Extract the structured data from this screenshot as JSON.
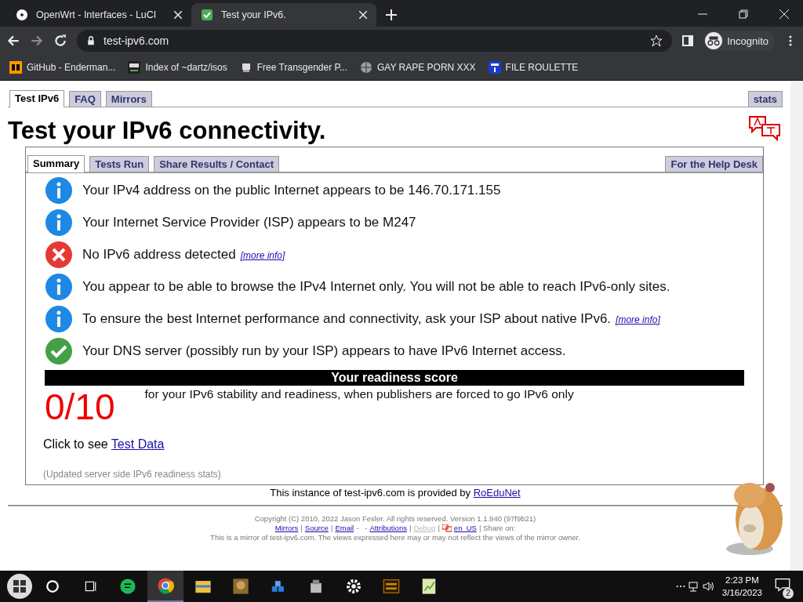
{
  "browser": {
    "tabs": [
      {
        "title": "OpenWrt - Interfaces - LuCI",
        "selected": false
      },
      {
        "title": "Test your IPv6.",
        "selected": true
      }
    ],
    "url": "test-ipv6.com",
    "profile": "Incognito",
    "bookmarks": [
      {
        "label": "GitHub - Enderman..."
      },
      {
        "label": "Index of ~dartz/isos"
      },
      {
        "label": "Free Transgender P..."
      },
      {
        "label": "GAY RAPE PORN XXX"
      },
      {
        "label": "FILE ROULETTE"
      }
    ]
  },
  "site_tabs": [
    {
      "label": "Test IPv6",
      "selected": true
    },
    {
      "label": "FAQ",
      "selected": false
    },
    {
      "label": "Mirrors",
      "selected": false
    }
  ],
  "stats_tab": "stats",
  "heading": "Test your IPv6 connectivity.",
  "panel_tabs": [
    {
      "label": "Summary",
      "selected": true
    },
    {
      "label": "Tests Run",
      "selected": false
    },
    {
      "label": "Share Results / Contact",
      "selected": false
    }
  ],
  "help_desk_tab": "For the Help Desk",
  "results": [
    {
      "kind": "info",
      "text": "Your IPv4 address on the public Internet appears to be 146.70.171.155"
    },
    {
      "kind": "info",
      "text": "Your Internet Service Provider (ISP) appears to be M247"
    },
    {
      "kind": "error",
      "text": "No IPv6 address detected",
      "link": "[more info]"
    },
    {
      "kind": "info",
      "text": "You appear to be able to browse the IPv4 Internet only. You will not be able to reach IPv6-only sites."
    },
    {
      "kind": "info",
      "text": "To ensure the best Internet performance and connectivity, ask your ISP about native IPv6.",
      "link": "[more info]"
    },
    {
      "kind": "ok",
      "text": "Your DNS server (possibly run by your ISP) appears to have IPv6 Internet access."
    }
  ],
  "readiness": {
    "title": "Your readiness score",
    "score": "0/10",
    "caption": "for your IPv6 stability and readiness, when publishers are forced to go IPv6 only"
  },
  "test_data": {
    "text": "Click to see",
    "link": "Test Data"
  },
  "updated_note": "(Updated server side IPv6 readiness stats)",
  "provider": {
    "text": "This instance of test-ipv6.com is provided by",
    "link": "RoEduNet"
  },
  "footer": {
    "copyright": "Copyright (C) 2010, 2022 Jason Fesler. All rights reserved. Version 1.1.940 (97f9b21)",
    "links": [
      {
        "kind": "link",
        "text": "Mirrors"
      },
      {
        "kind": "sep",
        "text": "|"
      },
      {
        "kind": "link",
        "text": "Source"
      },
      {
        "kind": "sep",
        "text": "|"
      },
      {
        "kind": "link",
        "text": "Email"
      },
      {
        "kind": "sep",
        "text": "-   -"
      },
      {
        "kind": "link",
        "text": "Attributions"
      },
      {
        "kind": "sep",
        "text": "|"
      },
      {
        "kind": "disabled",
        "text": "Debug"
      },
      {
        "kind": "sep",
        "text": "|"
      },
      {
        "kind": "lang",
        "text": "en_US"
      },
      {
        "kind": "sep",
        "text": "| Share on:"
      }
    ],
    "mirror_note": "This is a mirror of test-ipv6.com. The views expressed here may or may not reflect the views of the mirror owner."
  },
  "taskbar": {
    "apps": [
      {
        "selected": false
      },
      {
        "selected": true
      },
      {
        "selected": false
      },
      {
        "selected": false
      },
      {
        "selected": false
      },
      {
        "selected": false
      },
      {
        "selected": false
      },
      {
        "selected": false
      },
      {
        "selected": false
      }
    ],
    "time": "2:23 PM",
    "date": "3/16/2023",
    "notifications": "2"
  }
}
